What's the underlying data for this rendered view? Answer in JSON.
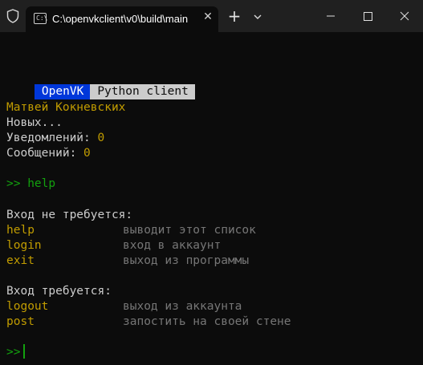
{
  "window": {
    "tab_title": "C:\\openvkclient\\v0\\build\\main",
    "tab_icon_text": "C:\\"
  },
  "badge": {
    "left": "OpenVK",
    "right": "Python client"
  },
  "profile": {
    "name": "Матвей Кокневских",
    "status": "Новых...",
    "notifications_label": "Уведомлений: ",
    "notifications_count": "0",
    "messages_label": "Сообщений: ",
    "messages_count": "0"
  },
  "prompt": {
    "symbol": ">>",
    "command": "help"
  },
  "help": {
    "no_auth_header": "Вход не требуется:",
    "no_auth_commands": [
      {
        "name": "help",
        "desc": "выводит этот список"
      },
      {
        "name": "login",
        "desc": "вход в аккаунт"
      },
      {
        "name": "exit",
        "desc": "выход из программы"
      }
    ],
    "auth_header": "Вход требуется:",
    "auth_commands": [
      {
        "name": "logout",
        "desc": "выход из аккаунта"
      },
      {
        "name": "post",
        "desc": "запостить на своей стене"
      }
    ]
  },
  "input": {
    "symbol": ">>",
    "value": ""
  },
  "colors": {
    "yellow": "#c19c00",
    "green": "#13a10e",
    "grey": "#767676",
    "badge_blue": "#0037da",
    "badge_grey": "#cccccc"
  }
}
